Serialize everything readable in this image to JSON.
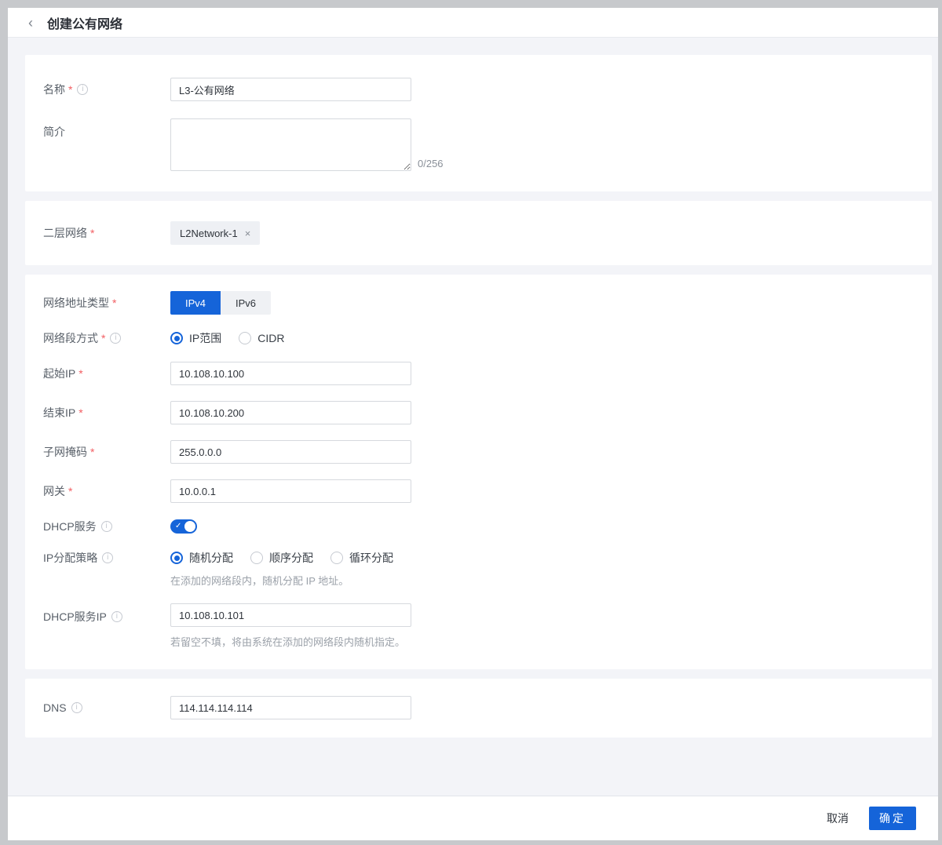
{
  "colors": {
    "accent": "#1564d9",
    "required": "#f25e62",
    "page_bg": "#f3f4f8",
    "frame": "#c7c9cc"
  },
  "glyphs": {
    "back": "‹",
    "info": "i",
    "required": "*",
    "remove": "×",
    "check": "✓"
  },
  "header": {
    "title": "创建公有网络"
  },
  "fields": {
    "name": {
      "label": "名称",
      "value": "L3-公有网络"
    },
    "description": {
      "label": "简介",
      "value": "",
      "counter": "0/256"
    },
    "l2network": {
      "label": "二层网络",
      "tag": "L2Network-1"
    },
    "ip_version": {
      "label": "网络地址类型",
      "options": [
        "IPv4",
        "IPv6"
      ],
      "selected": "IPv4"
    },
    "segment_method": {
      "label": "网络段方式",
      "options": [
        "IP范围",
        "CIDR"
      ],
      "selected": "IP范围"
    },
    "start_ip": {
      "label": "起始IP",
      "value": "10.108.10.100"
    },
    "end_ip": {
      "label": "结束IP",
      "value": "10.108.10.200"
    },
    "netmask": {
      "label": "子网掩码",
      "value": "255.0.0.0"
    },
    "gateway": {
      "label": "网关",
      "value": "10.0.0.1"
    },
    "dhcp": {
      "label": "DHCP服务",
      "enabled": true
    },
    "alloc_strategy": {
      "label": "IP分配策略",
      "options": [
        "随机分配",
        "顺序分配",
        "循环分配"
      ],
      "selected": "随机分配",
      "helper": "在添加的网络段内，随机分配 IP 地址。"
    },
    "dhcp_ip": {
      "label": "DHCP服务IP",
      "value": "10.108.10.101",
      "helper": "若留空不填，将由系统在添加的网络段内随机指定。"
    },
    "dns": {
      "label": "DNS",
      "value": "114.114.114.114"
    }
  },
  "footer": {
    "cancel": "取消",
    "confirm": "确定"
  }
}
